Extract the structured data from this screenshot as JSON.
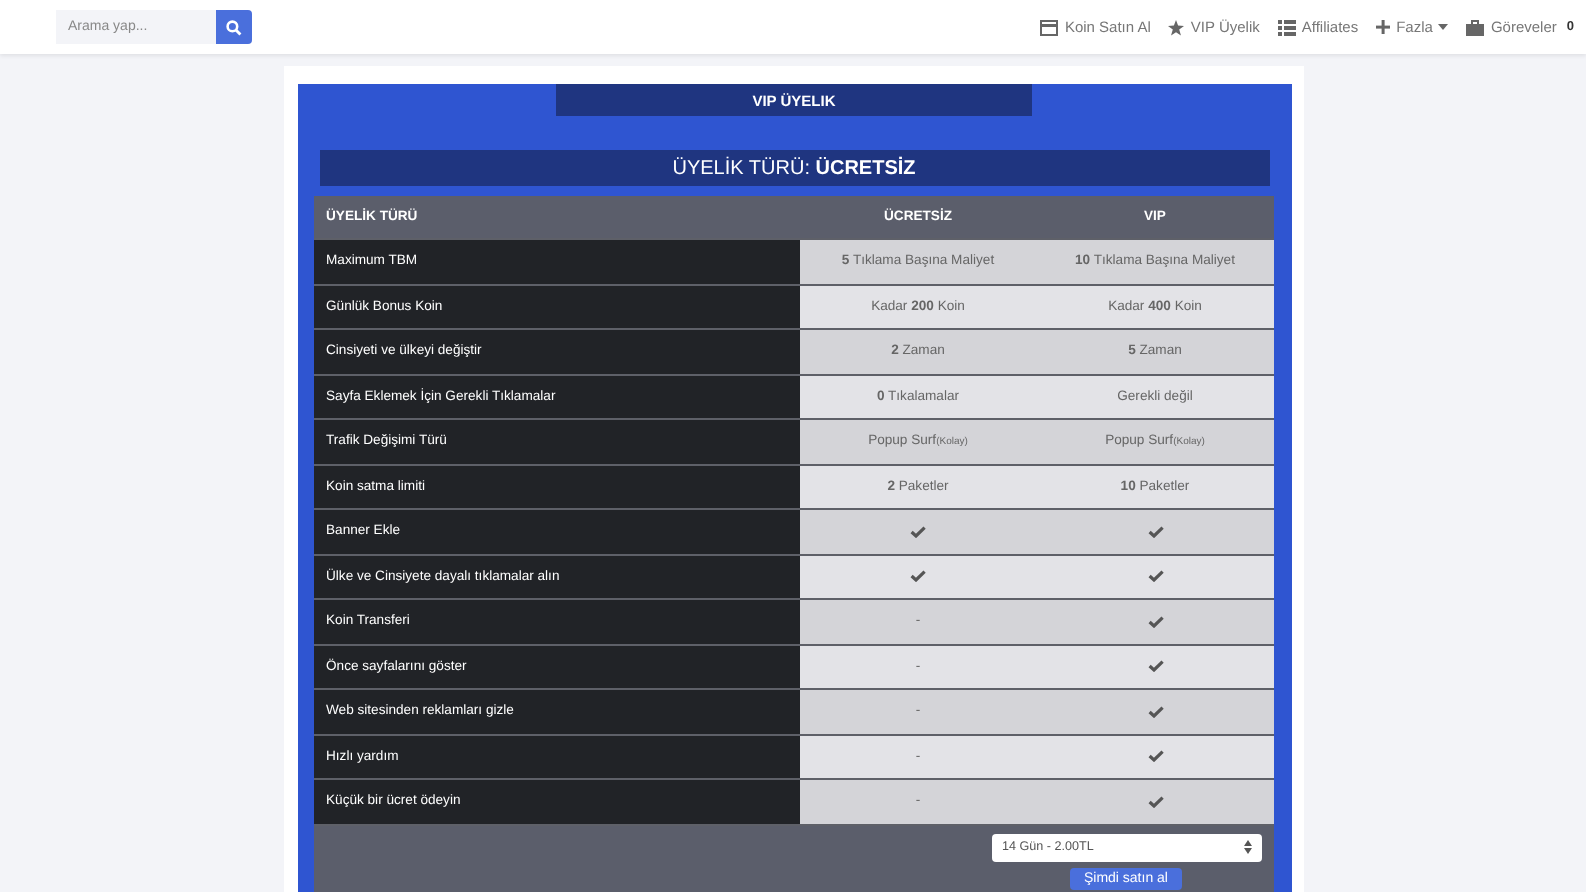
{
  "search": {
    "placeholder": "Arama yap..."
  },
  "nav": [
    {
      "label": "Koin Satın Al"
    },
    {
      "label": "VIP Üyelik"
    },
    {
      "label": "Affiliates"
    },
    {
      "label": "Fazla",
      "dropdown": true
    },
    {
      "label": "Göreveler",
      "badge": "0"
    }
  ],
  "panel": {
    "title": "VIP ÜYELIK",
    "membership": "ÜYELİK TÜRÜ: **ÜCRETSİZ**"
  },
  "table": {
    "columns": [
      "ÜYELİK TÜRÜ",
      "ÜCRETSİZ",
      "VIP"
    ],
    "rows": [
      {
        "cells": [
          {
            "kind": "label",
            "text": "Maximum TBM"
          },
          {
            "kind": "text",
            "text": "**5** Tıklama Başına Maliyet"
          },
          {
            "kind": "text",
            "text": "**10** Tıklama Başına Maliyet"
          }
        ]
      },
      {
        "cells": [
          {
            "kind": "label",
            "text": "Günlük Bonus Koin"
          },
          {
            "kind": "text",
            "text": "Kadar **200** Koin"
          },
          {
            "kind": "text",
            "text": "Kadar **400** Koin"
          }
        ]
      },
      {
        "cells": [
          {
            "kind": "label",
            "text": "Cinsiyeti ve ülkeyi değiştir"
          },
          {
            "kind": "text",
            "text": "**2** Zaman"
          },
          {
            "kind": "text",
            "text": "**5** Zaman"
          }
        ]
      },
      {
        "cells": [
          {
            "kind": "label",
            "text": "Sayfa Eklemek İçin Gerekli Tıklamalar"
          },
          {
            "kind": "text",
            "text": "**0** Tıkalamalar"
          },
          {
            "kind": "text",
            "text": "Gerekli değil"
          }
        ]
      },
      {
        "cells": [
          {
            "kind": "label",
            "text": "Trafik Değişimi Türü"
          },
          {
            "kind": "text",
            "text": "Popup Surf",
            "note": "(Kolay)"
          },
          {
            "kind": "text",
            "text": "Popup Surf",
            "note": "(Kolay)"
          }
        ]
      },
      {
        "cells": [
          {
            "kind": "label",
            "text": "Koin satma limiti"
          },
          {
            "kind": "text",
            "text": "**2** Paketler"
          },
          {
            "kind": "text",
            "text": "**10** Paketler"
          }
        ]
      },
      {
        "cells": [
          {
            "kind": "label",
            "text": "Banner Ekle"
          },
          {
            "kind": "check"
          },
          {
            "kind": "check"
          }
        ]
      },
      {
        "cells": [
          {
            "kind": "label",
            "text": "Ülke ve Cinsiyete dayalı tıklamalar alın"
          },
          {
            "kind": "check"
          },
          {
            "kind": "check"
          }
        ]
      },
      {
        "cells": [
          {
            "kind": "label",
            "text": "Koin Transferi"
          },
          {
            "kind": "text",
            "text": "-"
          },
          {
            "kind": "check"
          }
        ]
      },
      {
        "cells": [
          {
            "kind": "label",
            "text": "Önce sayfalarını göster"
          },
          {
            "kind": "text",
            "text": "-"
          },
          {
            "kind": "check"
          }
        ]
      },
      {
        "cells": [
          {
            "kind": "label",
            "text": "Web sitesinden reklamları gizle"
          },
          {
            "kind": "text",
            "text": "-"
          },
          {
            "kind": "check"
          }
        ]
      },
      {
        "cells": [
          {
            "kind": "label",
            "text": "Hızlı yardım"
          },
          {
            "kind": "text",
            "text": "-"
          },
          {
            "kind": "check"
          }
        ]
      },
      {
        "cells": [
          {
            "kind": "label",
            "text": "Küçük bir ücret ödeyin"
          },
          {
            "kind": "text",
            "text": "-"
          },
          {
            "kind": "check"
          }
        ]
      }
    ]
  },
  "plan_select": {
    "value": "14 Gün - 2.00TL"
  },
  "buy_button": "Şimdi satın al"
}
